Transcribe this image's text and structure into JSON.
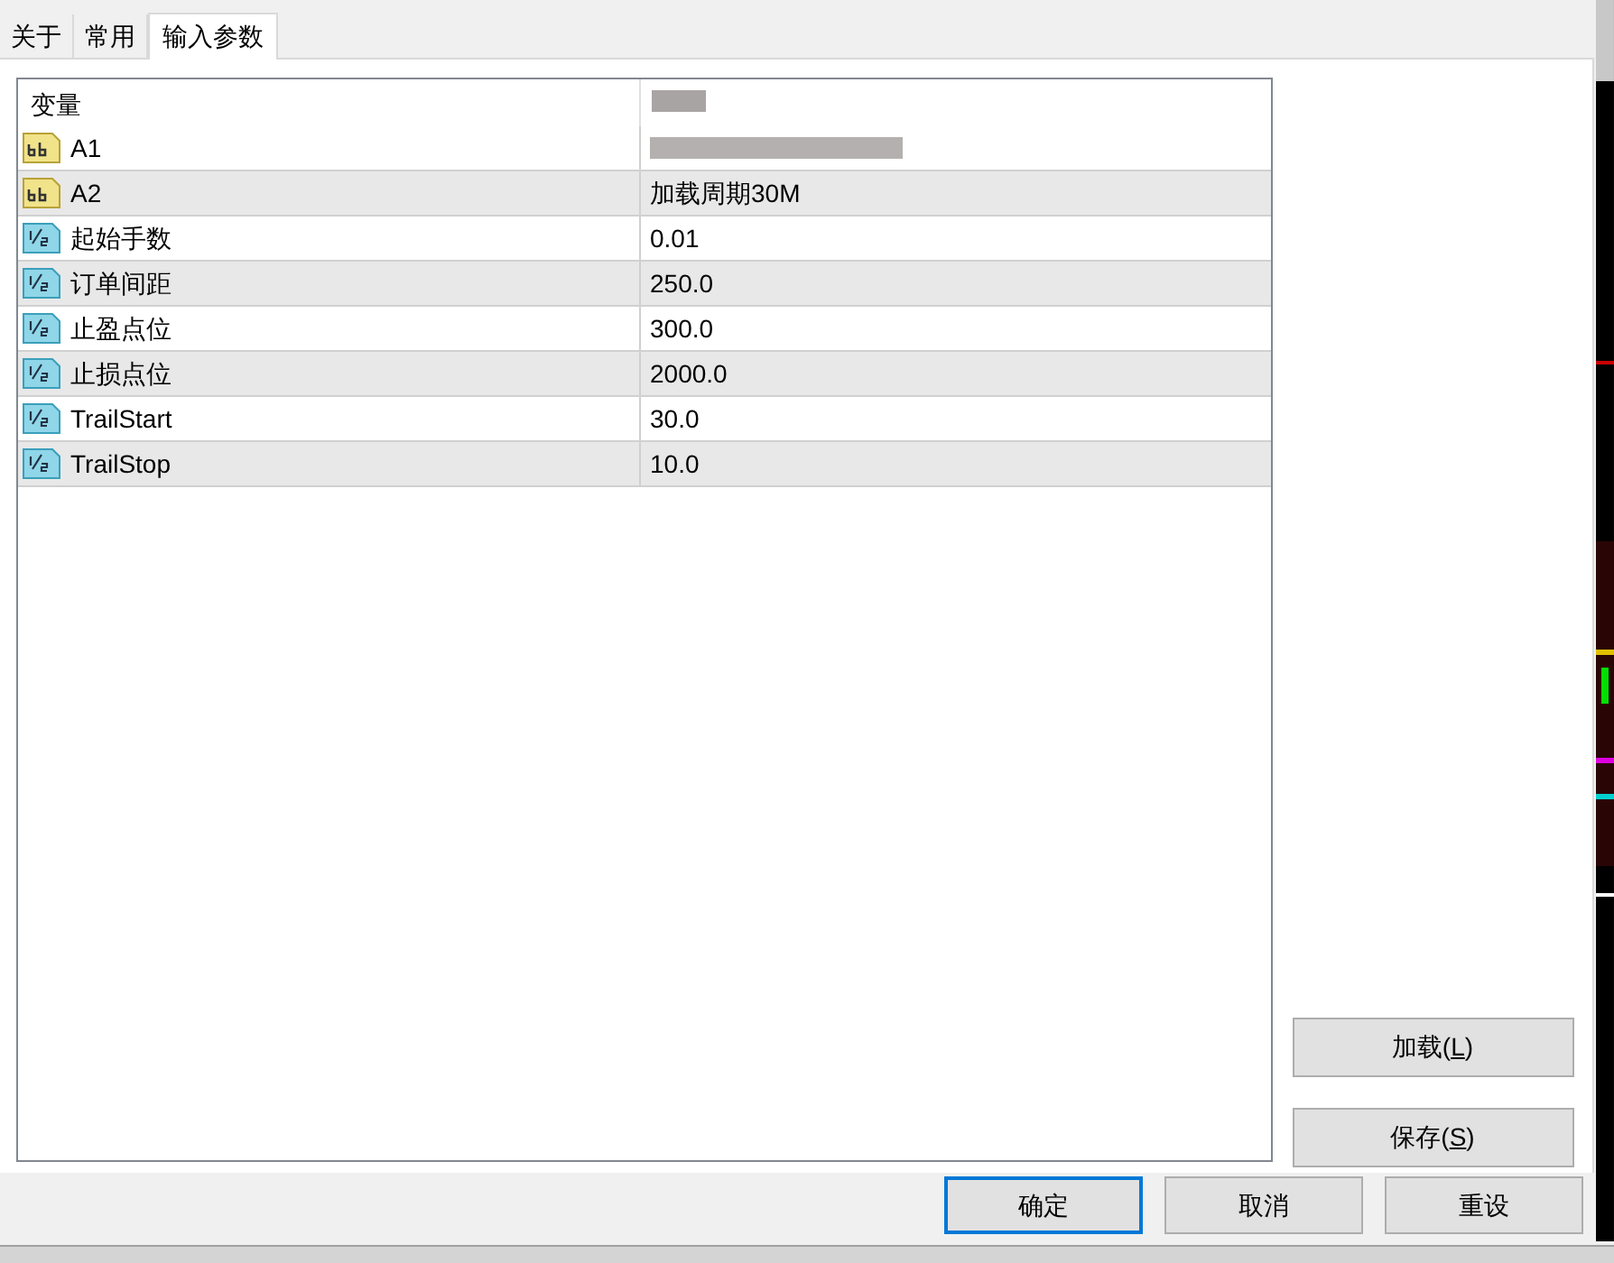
{
  "tabs": [
    {
      "label": "关于",
      "selected": false
    },
    {
      "label": "常用",
      "selected": false
    },
    {
      "label": "输入参数",
      "selected": true
    }
  ],
  "table": {
    "columns": [
      "变量"
    ],
    "rows": [
      {
        "kind": "text",
        "name": "A1",
        "value_blurred": true
      },
      {
        "kind": "text",
        "name": "A2",
        "value": "加载周期30M"
      },
      {
        "kind": "number",
        "name": "起始手数",
        "value": "0.01"
      },
      {
        "kind": "number",
        "name": "订单间距",
        "value": "250.0"
      },
      {
        "kind": "number",
        "name": "止盈点位",
        "value": "300.0"
      },
      {
        "kind": "number",
        "name": "止损点位",
        "value": "2000.0"
      },
      {
        "kind": "number",
        "name": "TrailStart",
        "value": "30.0"
      },
      {
        "kind": "number",
        "name": "TrailStop",
        "value": "10.0"
      }
    ]
  },
  "side_buttons": [
    {
      "label": "加载(",
      "key": "L",
      "end": ")"
    },
    {
      "label": "保存(",
      "key": "S",
      "end": ")"
    }
  ],
  "buttons": [
    {
      "label": "确定",
      "selected": true
    },
    {
      "label": "取消",
      "selected": false
    },
    {
      "label": "重设",
      "selected": false
    }
  ]
}
